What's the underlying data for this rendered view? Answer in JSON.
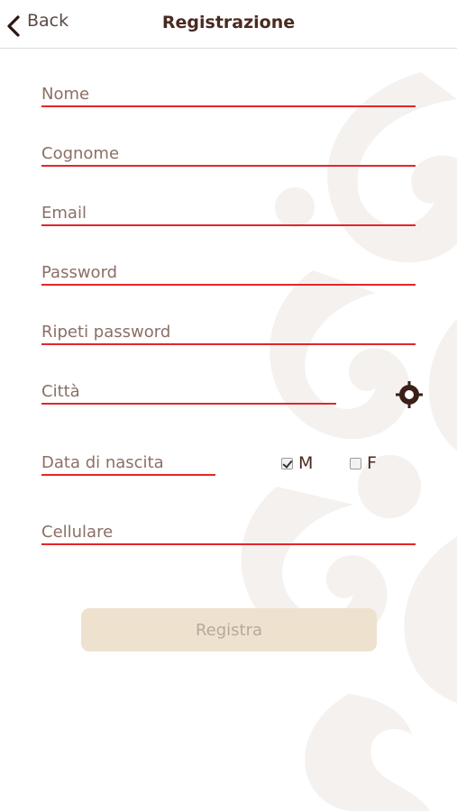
{
  "header": {
    "back_label": "Back",
    "title": "Registrazione"
  },
  "form": {
    "nome_placeholder": "Nome",
    "cognome_placeholder": "Cognome",
    "email_placeholder": "Email",
    "password_placeholder": "Password",
    "ripeti_password_placeholder": "Ripeti password",
    "citta_placeholder": "Città",
    "data_nascita_placeholder": "Data di nascita",
    "cellulare_placeholder": "Cellulare"
  },
  "gender": {
    "male_label": "M",
    "male_checked": true,
    "female_label": "F",
    "female_checked": false
  },
  "actions": {
    "register_label": "Registra"
  },
  "icons": {
    "back": "chevron-left-icon",
    "locate": "location-target-icon"
  },
  "colors": {
    "accent_line": "#e2262b",
    "brand_brown": "#4a2a20",
    "button_bg": "#eee2cf",
    "button_text": "#b8a99a"
  }
}
